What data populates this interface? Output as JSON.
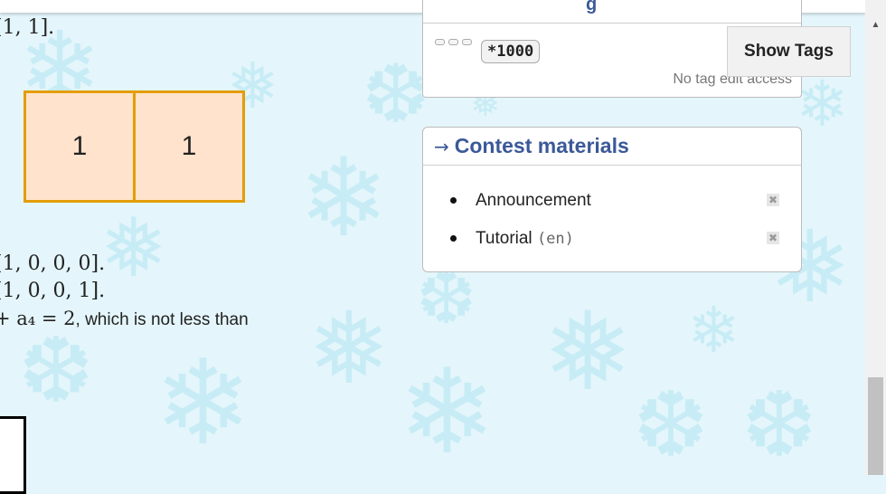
{
  "statement": {
    "line_top": "[1, 1].",
    "cells": [
      "1",
      "1"
    ],
    "array_line_1": "[1, 0, 0, 0].",
    "array_line_2": "[1, 0, 0, 1].",
    "sum_math": "+ a₄ = 2",
    "sum_text": ", which is not less than"
  },
  "tags_panel": {
    "title_fragment": "g",
    "tag": "*1000",
    "no_access": "No tag edit access",
    "show_tags_button": "Show Tags"
  },
  "contest_materials": {
    "arrow": "→",
    "title": "Contest materials",
    "items": [
      {
        "label": "Announcement",
        "lang": ""
      },
      {
        "label": "Tutorial",
        "lang": "(en)"
      }
    ],
    "remove_glyph": "✖"
  },
  "scrollbar": {
    "up_arrow": "▲"
  },
  "colors": {
    "background": "#e4f6fb",
    "cell_fill": "#ffe3cc",
    "cell_border": "#e39d07",
    "heading": "#3b5998"
  }
}
